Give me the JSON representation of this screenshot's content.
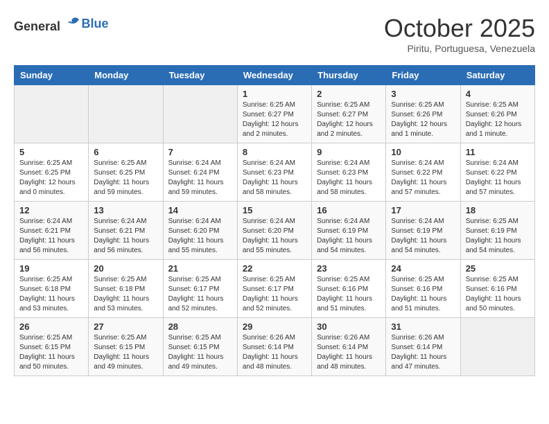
{
  "header": {
    "logo_general": "General",
    "logo_blue": "Blue",
    "month": "October 2025",
    "location": "Piritu, Portuguesa, Venezuela"
  },
  "days_of_week": [
    "Sunday",
    "Monday",
    "Tuesday",
    "Wednesday",
    "Thursday",
    "Friday",
    "Saturday"
  ],
  "weeks": [
    [
      {
        "day": "",
        "empty": true
      },
      {
        "day": "",
        "empty": true
      },
      {
        "day": "",
        "empty": true
      },
      {
        "day": "1",
        "sunrise": "6:25 AM",
        "sunset": "6:27 PM",
        "daylight": "12 hours and 2 minutes."
      },
      {
        "day": "2",
        "sunrise": "6:25 AM",
        "sunset": "6:27 PM",
        "daylight": "12 hours and 2 minutes."
      },
      {
        "day": "3",
        "sunrise": "6:25 AM",
        "sunset": "6:26 PM",
        "daylight": "12 hours and 1 minute."
      },
      {
        "day": "4",
        "sunrise": "6:25 AM",
        "sunset": "6:26 PM",
        "daylight": "12 hours and 1 minute."
      }
    ],
    [
      {
        "day": "5",
        "sunrise": "6:25 AM",
        "sunset": "6:25 PM",
        "daylight": "12 hours and 0 minutes."
      },
      {
        "day": "6",
        "sunrise": "6:25 AM",
        "sunset": "6:25 PM",
        "daylight": "11 hours and 59 minutes."
      },
      {
        "day": "7",
        "sunrise": "6:24 AM",
        "sunset": "6:24 PM",
        "daylight": "11 hours and 59 minutes."
      },
      {
        "day": "8",
        "sunrise": "6:24 AM",
        "sunset": "6:23 PM",
        "daylight": "11 hours and 58 minutes."
      },
      {
        "day": "9",
        "sunrise": "6:24 AM",
        "sunset": "6:23 PM",
        "daylight": "11 hours and 58 minutes."
      },
      {
        "day": "10",
        "sunrise": "6:24 AM",
        "sunset": "6:22 PM",
        "daylight": "11 hours and 57 minutes."
      },
      {
        "day": "11",
        "sunrise": "6:24 AM",
        "sunset": "6:22 PM",
        "daylight": "11 hours and 57 minutes."
      }
    ],
    [
      {
        "day": "12",
        "sunrise": "6:24 AM",
        "sunset": "6:21 PM",
        "daylight": "11 hours and 56 minutes."
      },
      {
        "day": "13",
        "sunrise": "6:24 AM",
        "sunset": "6:21 PM",
        "daylight": "11 hours and 56 minutes."
      },
      {
        "day": "14",
        "sunrise": "6:24 AM",
        "sunset": "6:20 PM",
        "daylight": "11 hours and 55 minutes."
      },
      {
        "day": "15",
        "sunrise": "6:24 AM",
        "sunset": "6:20 PM",
        "daylight": "11 hours and 55 minutes."
      },
      {
        "day": "16",
        "sunrise": "6:24 AM",
        "sunset": "6:19 PM",
        "daylight": "11 hours and 54 minutes."
      },
      {
        "day": "17",
        "sunrise": "6:24 AM",
        "sunset": "6:19 PM",
        "daylight": "11 hours and 54 minutes."
      },
      {
        "day": "18",
        "sunrise": "6:25 AM",
        "sunset": "6:19 PM",
        "daylight": "11 hours and 54 minutes."
      }
    ],
    [
      {
        "day": "19",
        "sunrise": "6:25 AM",
        "sunset": "6:18 PM",
        "daylight": "11 hours and 53 minutes."
      },
      {
        "day": "20",
        "sunrise": "6:25 AM",
        "sunset": "6:18 PM",
        "daylight": "11 hours and 53 minutes."
      },
      {
        "day": "21",
        "sunrise": "6:25 AM",
        "sunset": "6:17 PM",
        "daylight": "11 hours and 52 minutes."
      },
      {
        "day": "22",
        "sunrise": "6:25 AM",
        "sunset": "6:17 PM",
        "daylight": "11 hours and 52 minutes."
      },
      {
        "day": "23",
        "sunrise": "6:25 AM",
        "sunset": "6:16 PM",
        "daylight": "11 hours and 51 minutes."
      },
      {
        "day": "24",
        "sunrise": "6:25 AM",
        "sunset": "6:16 PM",
        "daylight": "11 hours and 51 minutes."
      },
      {
        "day": "25",
        "sunrise": "6:25 AM",
        "sunset": "6:16 PM",
        "daylight": "11 hours and 50 minutes."
      }
    ],
    [
      {
        "day": "26",
        "sunrise": "6:25 AM",
        "sunset": "6:15 PM",
        "daylight": "11 hours and 50 minutes."
      },
      {
        "day": "27",
        "sunrise": "6:25 AM",
        "sunset": "6:15 PM",
        "daylight": "11 hours and 49 minutes."
      },
      {
        "day": "28",
        "sunrise": "6:25 AM",
        "sunset": "6:15 PM",
        "daylight": "11 hours and 49 minutes."
      },
      {
        "day": "29",
        "sunrise": "6:26 AM",
        "sunset": "6:14 PM",
        "daylight": "11 hours and 48 minutes."
      },
      {
        "day": "30",
        "sunrise": "6:26 AM",
        "sunset": "6:14 PM",
        "daylight": "11 hours and 48 minutes."
      },
      {
        "day": "31",
        "sunrise": "6:26 AM",
        "sunset": "6:14 PM",
        "daylight": "11 hours and 47 minutes."
      },
      {
        "day": "",
        "empty": true
      }
    ]
  ]
}
